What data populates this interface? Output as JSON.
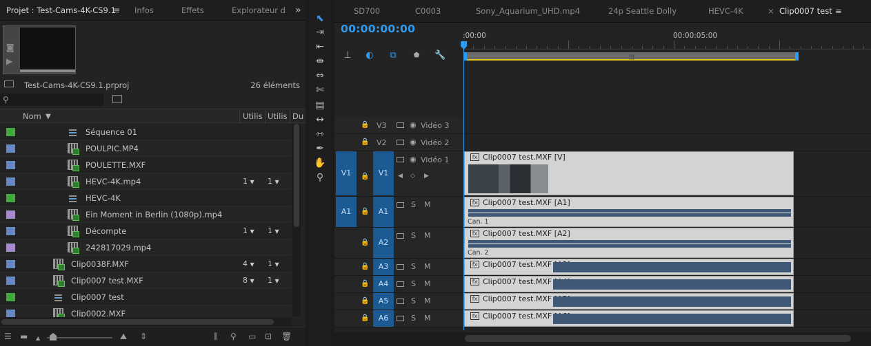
{
  "project": {
    "tabs": [
      {
        "label": "Projet : Test-Cams-4K-CS9.1",
        "active": true
      },
      {
        "label": "Infos"
      },
      {
        "label": "Effets"
      },
      {
        "label": "Explorateur d"
      }
    ],
    "menu_glyph": "≡",
    "overflow_glyph": "»",
    "project_file": "Test-Cams-4K-CS9.1.prproj",
    "item_count": "26 éléments",
    "search_placeholder": "",
    "columns": {
      "name": "Nom",
      "usage1": "Utilis",
      "usage2": "Utilis",
      "duration": "Du"
    },
    "rows": [
      {
        "swatch": "#41a93d",
        "icon": "sequence",
        "indent": 1,
        "name": "Séquence 01",
        "u1": "",
        "u2": ""
      },
      {
        "swatch": "#6688c2",
        "icon": "clip",
        "indent": 1,
        "name": "POULPIC.MP4",
        "u1": "",
        "u2": ""
      },
      {
        "swatch": "#6688c2",
        "icon": "clip",
        "indent": 1,
        "name": "POULETTE.MXF",
        "u1": "",
        "u2": ""
      },
      {
        "swatch": "#6688c2",
        "icon": "clip",
        "indent": 1,
        "name": "HEVC-4K.mp4",
        "u1": "1",
        "u2": "1"
      },
      {
        "swatch": "#41a93d",
        "icon": "sequence",
        "indent": 1,
        "name": "HEVC-4K",
        "u1": "",
        "u2": ""
      },
      {
        "swatch": "#a888cf",
        "icon": "clip",
        "indent": 1,
        "name": "Ein Moment in Berlin (1080p).mp4",
        "u1": "",
        "u2": ""
      },
      {
        "swatch": "#6688c2",
        "icon": "clip",
        "indent": 1,
        "name": "Décompte",
        "u1": "1",
        "u2": "1"
      },
      {
        "swatch": "#a888cf",
        "icon": "clip",
        "indent": 1,
        "name": "242817029.mp4",
        "u1": "",
        "u2": ""
      },
      {
        "swatch": "#6688c2",
        "icon": "clip",
        "indent": 0,
        "name": "Clip0038F.MXF",
        "u1": "4",
        "u2": "1"
      },
      {
        "swatch": "#6688c2",
        "icon": "clip",
        "indent": 0,
        "name": "Clip0007 test.MXF",
        "u1": "8",
        "u2": "1"
      },
      {
        "swatch": "#41a93d",
        "icon": "sequence",
        "indent": 0,
        "name": "Clip0007 test",
        "u1": "",
        "u2": ""
      },
      {
        "swatch": "#6688c2",
        "icon": "clip",
        "indent": 0,
        "name": "Clip0002.MXF",
        "u1": "",
        "u2": ""
      }
    ]
  },
  "timeline": {
    "tabs": [
      {
        "label": "SD700"
      },
      {
        "label": "C0003"
      },
      {
        "label": "Sony_Aquarium_UHD.mp4"
      },
      {
        "label": "24p Seattle Dolly"
      },
      {
        "label": "HEVC-4K"
      },
      {
        "label": "Clip0007 test",
        "active": true,
        "closable": true
      }
    ],
    "close_glyph": "×",
    "menu_glyph": "≡",
    "timecode": "00:00:00:00",
    "ruler_labels": [
      ":00:00",
      "00:00:05:00"
    ],
    "video_tracks": [
      {
        "id": "V3",
        "name": "Vidéo 3"
      },
      {
        "id": "V2",
        "name": "Vidéo 2"
      },
      {
        "id": "V1",
        "name": "Vidéo 1",
        "source": "V1",
        "clip": "Clip0007 test.MXF [V]"
      }
    ],
    "audio_tracks": [
      {
        "id": "A1",
        "source": "A1",
        "clip": "Clip0007 test.MXF [A1]",
        "channel": "Can. 1"
      },
      {
        "id": "A2",
        "clip": "Clip0007 test.MXF [A2]",
        "channel": "Can. 2"
      },
      {
        "id": "A3",
        "clip": "Clip0007 test.MXF [A3]"
      },
      {
        "id": "A4",
        "clip": "Clip0007 test.MXF [A4]"
      },
      {
        "id": "A5",
        "clip": "Clip0007 test.MXF [A5]"
      },
      {
        "id": "A6",
        "clip": "Clip0007 test.MXF [A6]"
      }
    ],
    "solo_label": "S",
    "mute_label": "M",
    "fx_label": "fx"
  },
  "colors": {
    "accent_blue": "#2f9bf0",
    "track_target": "#1c5a94",
    "audio_clip": "#3f5876",
    "work_area": "#e6c619"
  }
}
